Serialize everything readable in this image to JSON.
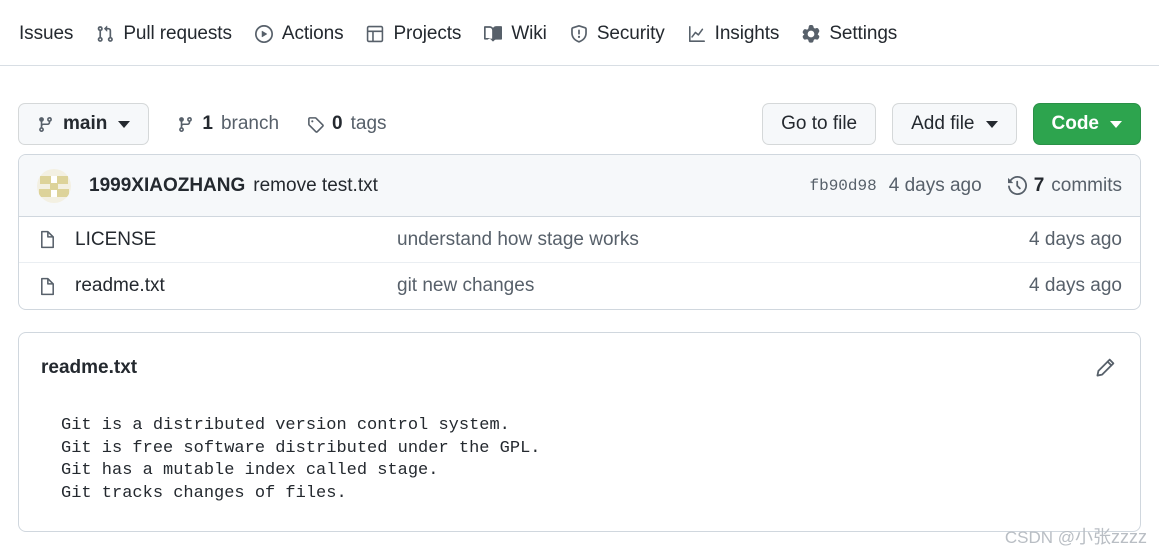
{
  "repo_nav": {
    "items": [
      {
        "label": "Issues",
        "icon": "issue-opened-icon",
        "has_icon": false
      },
      {
        "label": "Pull requests",
        "icon": "git-pull-request-icon",
        "has_icon": true
      },
      {
        "label": "Actions",
        "icon": "play-circle-icon",
        "has_icon": true
      },
      {
        "label": "Projects",
        "icon": "table-grid-icon",
        "has_icon": true
      },
      {
        "label": "Wiki",
        "icon": "book-icon",
        "has_icon": true
      },
      {
        "label": "Security",
        "icon": "shield-icon",
        "has_icon": true
      },
      {
        "label": "Insights",
        "icon": "graph-line-icon",
        "has_icon": true
      },
      {
        "label": "Settings",
        "icon": "gear-icon",
        "has_icon": true
      }
    ]
  },
  "toolbar": {
    "branch_button": {
      "label": "main",
      "icon": "git-branch-icon"
    },
    "branch_count": {
      "value": "1",
      "label": "branch",
      "icon": "git-branch-icon"
    },
    "tag_count": {
      "value": "0",
      "label": "tags",
      "icon": "tag-icon"
    },
    "go_to_file": "Go to file",
    "add_file": "Add file",
    "code": "Code"
  },
  "commit_header": {
    "author": "1999XIAOZHANG",
    "message": "remove test.txt",
    "sha": "fb90d98",
    "date": "4 days ago",
    "commits_value": "7",
    "commits_label": "commits",
    "commits_icon": "history-clock-icon",
    "avatar": "user-avatar"
  },
  "files": [
    {
      "name": "LICENSE",
      "icon": "file-icon",
      "message": "understand how stage works",
      "time": "4 days ago"
    },
    {
      "name": "readme.txt",
      "icon": "file-icon",
      "message": "git new changes",
      "time": "4 days ago"
    }
  ],
  "readme": {
    "title": "readme.txt",
    "edit_icon": "pencil-icon",
    "content": "Git is a distributed version control system.\nGit is free software distributed under the GPL.\nGit has a mutable index called stage.\nGit tracks changes of files."
  },
  "watermark": {
    "prefix": "CSDN @",
    "name": "小张zzzz"
  },
  "colors": {
    "accent_green": "#2da44e",
    "text_primary": "#24292f",
    "text_muted": "#57606a",
    "border": "#d0d7de",
    "header_bg": "#f6f8fa"
  }
}
